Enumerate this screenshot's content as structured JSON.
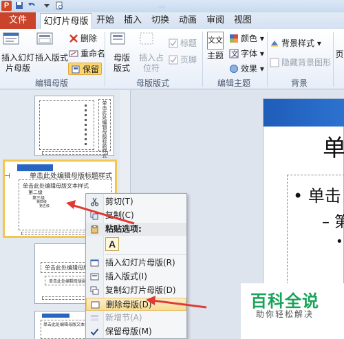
{
  "titlebar": {
    "app_icon": "P",
    "doc_title": "…"
  },
  "tabs": {
    "file": "文件",
    "items": [
      "幻灯片母版",
      "开始",
      "插入",
      "切换",
      "动画",
      "审阅",
      "视图"
    ]
  },
  "ribbon": {
    "insert_slide_master": "插入幻灯片母版",
    "insert_layout": "插入版式",
    "delete": "删除",
    "rename": "重命名",
    "preserve": "保留",
    "master_layout": "母版版式",
    "insert_placeholder": "插入占位符",
    "title_chk": "标题",
    "footer_chk": "页脚",
    "themes": "主题",
    "colors": "颜色",
    "fonts": "字体",
    "effects": "效果",
    "bg_styles": "背景样式",
    "hide_bg": "隐藏背景图形",
    "groups": {
      "edit_master": "编辑母版",
      "master_layout": "母版版式",
      "edit_theme": "编辑主题",
      "background": "背景"
    },
    "theme_icon_text": "文文"
  },
  "slides_pane": {
    "slide1_title": "单击此处编辑母版标题样式",
    "slide2_number": "2",
    "slide2_title": "单击此处编辑母版标题样式",
    "slide2_l1": "单击此处编辑母版文本样式",
    "slide2_l2": "第二级",
    "slide2_l3": "第三级",
    "slide2_l4": "第四级",
    "slide2_l5": "第五级",
    "slide3_title": "单击此处编辑母版标题样式",
    "slide3_sub": "单击此处编辑母版副标题样式",
    "slide4_l1": "单击此处编辑母版文本样式"
  },
  "main_slide": {
    "title": "单",
    "bullet1": "单击",
    "bullet2": "第",
    "bullet3": "•"
  },
  "context_menu": {
    "items": [
      {
        "label": "剪切(T)",
        "icon": "scissors-icon"
      },
      {
        "label": "复制(C)",
        "icon": "copy-icon"
      },
      {
        "label": "粘贴选项:",
        "icon": "paste-icon"
      },
      {
        "label": "插入幻灯片母版(R)",
        "icon": "insert-master-icon"
      },
      {
        "label": "插入版式(I)",
        "icon": "insert-layout-icon"
      },
      {
        "label": "复制幻灯片母版(D)",
        "icon": "duplicate-master-icon"
      },
      {
        "label": "删除母版(D)",
        "icon": "delete-master-icon"
      },
      {
        "label": "新增节(A)",
        "icon": "add-section-icon"
      },
      {
        "label": "保留母版(M)",
        "icon": "check-icon"
      }
    ],
    "paste_option": "A"
  },
  "watermark": {
    "title": "百科全说",
    "subtitle": "助你轻松解决"
  },
  "colors": {
    "file_tab": "#c9442a",
    "accent_blue": "#2765c0",
    "selection": "#f3c64f",
    "arrow": "#e03a35",
    "watermark_green": "#19a35a"
  }
}
